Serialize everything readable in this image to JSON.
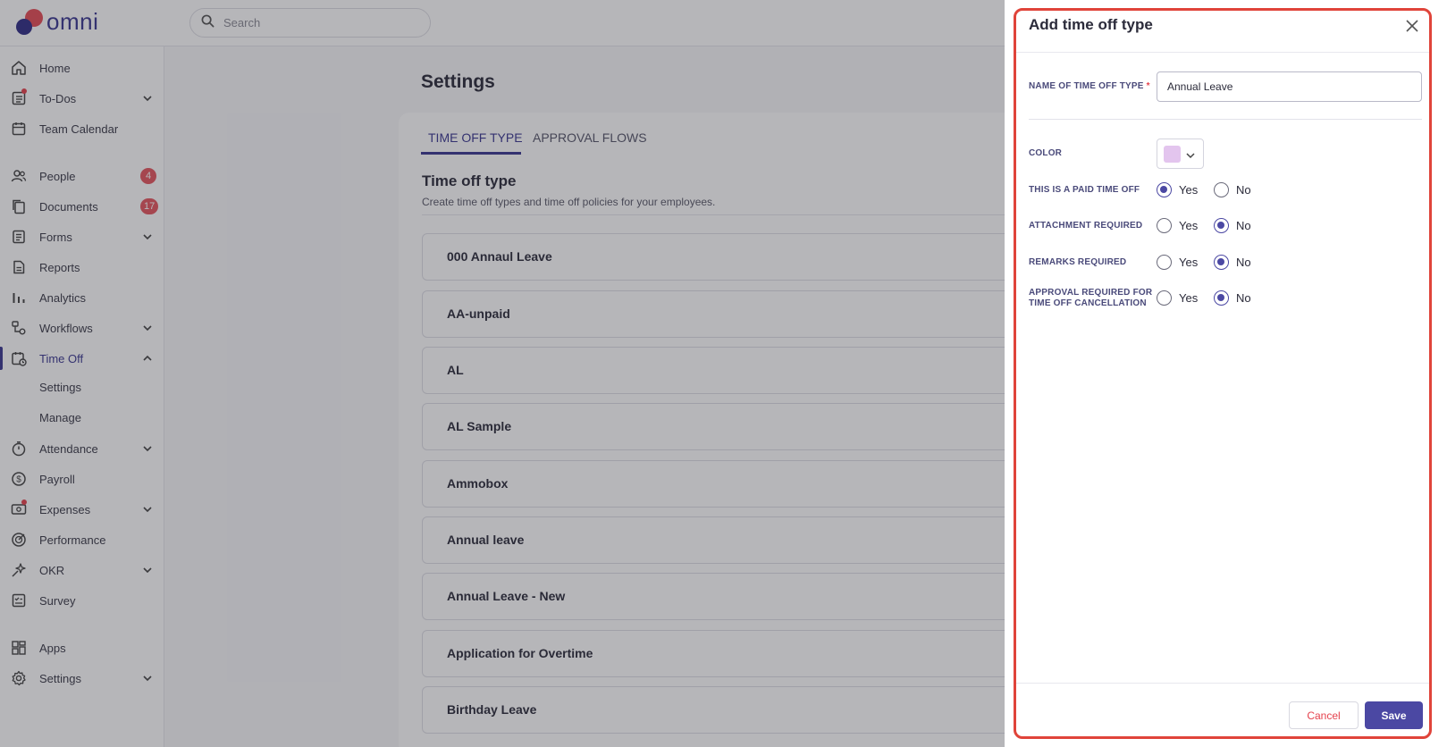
{
  "app": {
    "logo_text": "omni"
  },
  "search": {
    "placeholder": "Search"
  },
  "sidebar": {
    "items": [
      {
        "label": "Home",
        "icon": "home-icon"
      },
      {
        "label": "To-Dos",
        "icon": "todos-icon",
        "has_dot": true,
        "expandable": true
      },
      {
        "label": "Team Calendar",
        "icon": "calendar-icon"
      },
      {
        "label": "People",
        "icon": "people-icon",
        "badge": "4"
      },
      {
        "label": "Documents",
        "icon": "documents-icon",
        "badge": "17"
      },
      {
        "label": "Forms",
        "icon": "forms-icon",
        "expandable": true
      },
      {
        "label": "Reports",
        "icon": "reports-icon"
      },
      {
        "label": "Analytics",
        "icon": "analytics-icon"
      },
      {
        "label": "Workflows",
        "icon": "workflows-icon",
        "expandable": true
      },
      {
        "label": "Time Off",
        "icon": "time-off-icon",
        "expanded": true,
        "active": true
      },
      {
        "label": "Attendance",
        "icon": "attendance-icon",
        "expandable": true
      },
      {
        "label": "Payroll",
        "icon": "payroll-icon"
      },
      {
        "label": "Expenses",
        "icon": "expenses-icon",
        "has_dot": true,
        "expandable": true
      },
      {
        "label": "Performance",
        "icon": "performance-icon"
      },
      {
        "label": "OKR",
        "icon": "okr-icon",
        "expandable": true
      },
      {
        "label": "Survey",
        "icon": "survey-icon"
      },
      {
        "label": "Apps",
        "icon": "apps-icon"
      },
      {
        "label": "Settings",
        "icon": "settings-icon",
        "expandable": true
      }
    ],
    "time_off_sub": [
      {
        "label": "Settings"
      },
      {
        "label": "Manage"
      }
    ]
  },
  "main": {
    "title": "Settings",
    "tabs": [
      {
        "label": "TIME OFF TYPE",
        "active": true
      },
      {
        "label": "APPROVAL FLOWS"
      }
    ],
    "section_title": "Time off type",
    "section_subtitle": "Create time off types and time off policies for your employees.",
    "types": [
      "000 Annaul Leave",
      "AA-unpaid",
      "AL",
      "AL Sample",
      "Ammobox",
      "Annual leave",
      "Annual Leave - New",
      "Application for Overtime",
      "Birthday Leave"
    ]
  },
  "drawer": {
    "title": "Add time off type",
    "name_label": "NAME OF TIME OFF TYPE",
    "name_required_mark": "*",
    "name_value": "Annual Leave",
    "color_label": "COLOR",
    "color_value": "#e3c5ee",
    "yes_label": "Yes",
    "no_label": "No",
    "questions": [
      {
        "label": "THIS IS A PAID TIME OFF",
        "selected": "Yes"
      },
      {
        "label": "ATTACHMENT REQUIRED",
        "selected": "No"
      },
      {
        "label": "REMARKS REQUIRED",
        "selected": "No"
      },
      {
        "label_line1": "APPROVAL REQUIRED FOR",
        "label_line2": "TIME OFF CANCELLATION",
        "selected": "No"
      }
    ],
    "cancel_label": "Cancel",
    "save_label": "Save"
  },
  "colors": {
    "accent": "#3a3790",
    "danger": "#e5424d",
    "highlight_outline": "#e0443a"
  }
}
